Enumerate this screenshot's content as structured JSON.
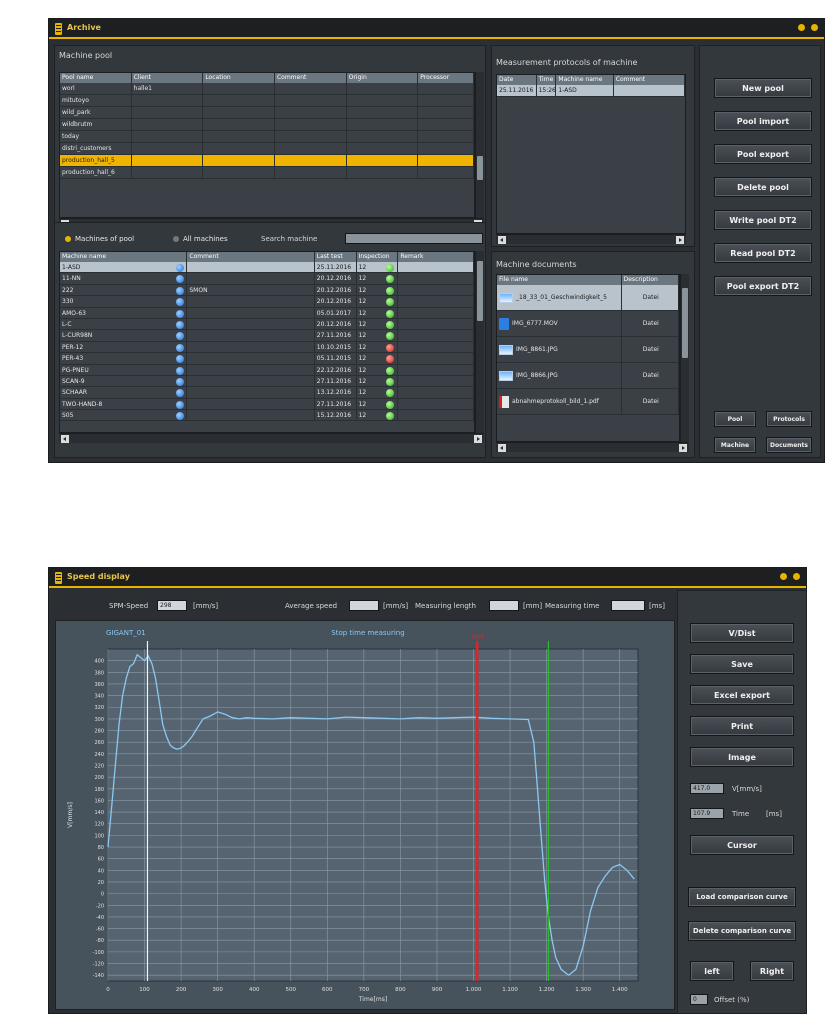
{
  "colors": {
    "accent": "#e8b400",
    "window_bg": "#2b2f33",
    "selected_row": "#f0b400",
    "curve": "#8cc8f0",
    "red_cursor": "#d62828",
    "green_cursor": "#28c028"
  },
  "archive": {
    "title": "Archive",
    "machine_pool": {
      "title": "Machine pool",
      "columns": [
        "Pool name",
        "Client",
        "Location",
        "Comment",
        "Origin",
        "Processor"
      ],
      "rows": [
        [
          "worl",
          "halle1",
          "",
          "",
          "",
          ""
        ],
        [
          "mitutoyo",
          "",
          "",
          "",
          "",
          ""
        ],
        [
          "wild_park",
          "",
          "",
          "",
          "",
          ""
        ],
        [
          "wildbrutm",
          "",
          "",
          "",
          "",
          ""
        ],
        [
          "today",
          "",
          "",
          "",
          "",
          ""
        ],
        [
          "distri_customers",
          "",
          "",
          "",
          "",
          ""
        ],
        [
          "production_hall_5",
          "",
          "",
          "",
          "",
          ""
        ],
        [
          "production_hall_6",
          "",
          "",
          "",
          "",
          ""
        ]
      ],
      "selected_index": 6
    },
    "machines": {
      "radio_pool": "Machines of pool",
      "radio_all": "All machines",
      "search_label": "Search machine",
      "search_value": "",
      "columns": [
        "Machine name",
        "Comment",
        "Last test",
        "Inspection",
        "Remark"
      ],
      "rows": [
        {
          "name": "1-ASD",
          "comment": "",
          "last_test": "25.11.2016",
          "inspection": "12",
          "status": "green"
        },
        {
          "name": "11-NN",
          "comment": "",
          "last_test": "20.12.2016",
          "inspection": "12",
          "status": "green"
        },
        {
          "name": "222",
          "comment": "SMON",
          "last_test": "20.12.2016",
          "inspection": "12",
          "status": "green"
        },
        {
          "name": "330",
          "comment": "",
          "last_test": "20.12.2016",
          "inspection": "12",
          "status": "green"
        },
        {
          "name": "AMO-63",
          "comment": "",
          "last_test": "05.01.2017",
          "inspection": "12",
          "status": "green"
        },
        {
          "name": "L-C",
          "comment": "",
          "last_test": "20.12.2016",
          "inspection": "12",
          "status": "green"
        },
        {
          "name": "L-CUR98N",
          "comment": "",
          "last_test": "27.11.2016",
          "inspection": "12",
          "status": "green"
        },
        {
          "name": "PER-12",
          "comment": "",
          "last_test": "10.10.2015",
          "inspection": "12",
          "status": "red"
        },
        {
          "name": "PER-43",
          "comment": "",
          "last_test": "05.11.2015",
          "inspection": "12",
          "status": "red"
        },
        {
          "name": "PG-PNEU",
          "comment": "",
          "last_test": "22.12.2016",
          "inspection": "12",
          "status": "green"
        },
        {
          "name": "SCAN-9",
          "comment": "",
          "last_test": "27.11.2016",
          "inspection": "12",
          "status": "green"
        },
        {
          "name": "SCHAAR",
          "comment": "",
          "last_test": "13.12.2016",
          "inspection": "12",
          "status": "green"
        },
        {
          "name": "TWO-HAND-8",
          "comment": "",
          "last_test": "27.11.2016",
          "inspection": "12",
          "status": "green"
        },
        {
          "name": "S05",
          "comment": "",
          "last_test": "15.12.2016",
          "inspection": "12",
          "status": "green"
        }
      ],
      "selected_index": 0
    },
    "protocols": {
      "title": "Measurement protocols of machine",
      "columns": [
        "Date",
        "Time",
        "Machine name",
        "Comment"
      ],
      "rows": [
        [
          "25.11.2016",
          "15:26",
          "1-ASD",
          ""
        ]
      ]
    },
    "documents": {
      "title": "Machine documents",
      "columns": [
        "File name",
        "Description"
      ],
      "rows": [
        {
          "file": "_18_33_01_Geschwindigkeit_5",
          "desc": "Datei",
          "icon": "image-file-icon"
        },
        {
          "file": "IMG_6777.MOV",
          "desc": "Datei",
          "icon": "video-file-icon"
        },
        {
          "file": "IMG_8861.JPG",
          "desc": "Datei",
          "icon": "image-file-icon"
        },
        {
          "file": "IMG_8866.JPG",
          "desc": "Datei",
          "icon": "image-file-icon"
        },
        {
          "file": "abnahmeprotokoll_bild_1.pdf",
          "desc": "Datei",
          "icon": "pdf-file-icon"
        }
      ]
    },
    "buttons": [
      "New pool",
      "Pool import",
      "Pool export",
      "Delete pool",
      "Write pool DT2",
      "Read pool DT2",
      "Pool export DT2"
    ],
    "small_buttons": [
      "Pool",
      "Protocols",
      "Machine",
      "Documents"
    ]
  },
  "speed": {
    "title": "Speed display",
    "spm_label": "SPM-Speed",
    "spm_value": "298",
    "spm_unit": "[mm/s]",
    "avg_label": "Average speed",
    "avg_value": "",
    "avg_unit": "[mm/s]",
    "len_label": "Measuring length",
    "len_value": "",
    "len_unit": "[mm]",
    "time_label": "Measuring time",
    "time_value": "",
    "time_unit": "[ms]",
    "buttons": [
      "V/Dist",
      "Save",
      "Excel export",
      "Print",
      "Image",
      "Cursor",
      "Load comparison curve",
      "Delete comparison curve",
      "left",
      "Right"
    ],
    "v_value": "417.0",
    "v_label": "V[mm/s]",
    "t_value": "107.9",
    "t_label": "Time",
    "t_unit": "[ms]",
    "offset_value": "0",
    "offset_label": "Offset (%)"
  },
  "chart_data": {
    "type": "line",
    "title": "Stop time measuring",
    "subtitle": "GIGANT_01",
    "xlabel": "Time[ms]",
    "ylabel": "V[mm/s]",
    "xlim": [
      0,
      1450
    ],
    "ylim": [
      -150,
      420
    ],
    "x_ticks": [
      0,
      100,
      200,
      300,
      400,
      500,
      600,
      700,
      800,
      900,
      1000,
      1100,
      1200,
      1300,
      1400
    ],
    "x_tick_labels": [
      "0",
      "100",
      "200",
      "300",
      "400",
      "500",
      "600",
      "700",
      "800",
      "900",
      "1.000",
      "1.100",
      "1.200",
      "1.300",
      "1.400"
    ],
    "y_ticks": [
      -140,
      -120,
      -100,
      -80,
      -60,
      -40,
      -20,
      0,
      20,
      40,
      60,
      80,
      100,
      120,
      140,
      160,
      180,
      200,
      220,
      240,
      260,
      280,
      300,
      320,
      340,
      360,
      380,
      400
    ],
    "grid": true,
    "cursors": [
      {
        "x": 1010,
        "color": "red",
        "label": "SPM"
      },
      {
        "x": 1205,
        "color": "green",
        "label": ""
      },
      {
        "x": 108,
        "color": "white",
        "label": ""
      }
    ],
    "series": [
      {
        "x": [
          0,
          10,
          20,
          30,
          40,
          50,
          60,
          70,
          80,
          90,
          100,
          110,
          120,
          130,
          140,
          150,
          160,
          170,
          180,
          190,
          200,
          210,
          220,
          230,
          240,
          250,
          260,
          280,
          300,
          320,
          340,
          360,
          380,
          400,
          450,
          500,
          550,
          600,
          650,
          700,
          750,
          800,
          850,
          900,
          950,
          1000,
          1050,
          1100,
          1150,
          1165,
          1175,
          1185,
          1195,
          1205,
          1215,
          1225,
          1240,
          1260,
          1280,
          1300,
          1320,
          1340,
          1360,
          1380,
          1400,
          1420,
          1440
        ],
        "y": [
          80,
          150,
          220,
          290,
          340,
          370,
          390,
          395,
          410,
          405,
          400,
          408,
          395,
          370,
          330,
          290,
          270,
          255,
          250,
          248,
          250,
          255,
          262,
          270,
          280,
          290,
          300,
          305,
          312,
          308,
          302,
          300,
          302,
          301,
          300,
          302,
          301,
          300,
          303,
          302,
          301,
          300,
          302,
          301,
          302,
          303,
          301,
          300,
          299,
          260,
          180,
          100,
          20,
          -40,
          -80,
          -110,
          -130,
          -140,
          -130,
          -90,
          -30,
          10,
          30,
          45,
          50,
          40,
          25
        ]
      }
    ]
  }
}
